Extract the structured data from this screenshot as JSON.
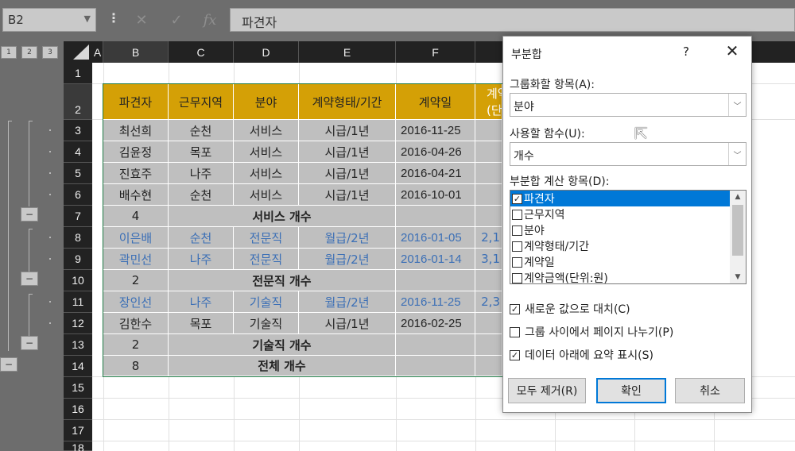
{
  "formula_bar": {
    "name_box": "B2",
    "formula": "파견자",
    "cancel_glyph": "✕",
    "enter_glyph": "✓",
    "fx_glyph": "fx"
  },
  "outline": {
    "levels": [
      "1",
      "2",
      "3"
    ],
    "collapse_glyph": "−"
  },
  "columns": [
    "A",
    "B",
    "C",
    "D",
    "E",
    "F"
  ],
  "rows": [
    "1",
    "2",
    "3",
    "4",
    "5",
    "6",
    "7",
    "8",
    "9",
    "10",
    "11",
    "12",
    "13",
    "14",
    "15",
    "16",
    "17",
    "18"
  ],
  "table": {
    "headers": [
      "파견자",
      "근무지역",
      "분야",
      "계약형태/기간",
      "계약일",
      "계약",
      "(단"
    ],
    "data_rows": [
      {
        "cells": [
          "최선희",
          "순천",
          "서비스",
          "시급/1년",
          "2016-11-25",
          ""
        ],
        "blue": false
      },
      {
        "cells": [
          "김윤정",
          "목포",
          "서비스",
          "시급/1년",
          "2016-04-26",
          ""
        ],
        "blue": false
      },
      {
        "cells": [
          "진효주",
          "나주",
          "서비스",
          "시급/1년",
          "2016-04-21",
          ""
        ],
        "blue": false
      },
      {
        "cells": [
          "배수현",
          "순천",
          "서비스",
          "시급/1년",
          "2016-10-01",
          ""
        ],
        "blue": false
      },
      {
        "cells": [
          "이은배",
          "순천",
          "전문직",
          "월급/2년",
          "2016-01-05",
          "2,1"
        ],
        "blue": true
      },
      {
        "cells": [
          "곽민선",
          "나주",
          "전문직",
          "월급/2년",
          "2016-01-14",
          "3,1"
        ],
        "blue": true
      },
      {
        "cells": [
          "장인선",
          "나주",
          "기술직",
          "월급/2년",
          "2016-11-25",
          "2,3"
        ],
        "blue": true
      },
      {
        "cells": [
          "김한수",
          "목포",
          "기술직",
          "시급/1년",
          "2016-02-25",
          ""
        ],
        "blue": false
      }
    ],
    "subtotals": [
      {
        "count": "4",
        "label": "서비스 개수"
      },
      {
        "count": "2",
        "label": "전문직 개수"
      },
      {
        "count": "2",
        "label": "기술직 개수"
      },
      {
        "count": "8",
        "label": "전체 개수"
      }
    ]
  },
  "dialog": {
    "title": "부분합",
    "help": "?",
    "close": "✕",
    "group_label": "그룹화할 항목(A):",
    "group_value": "분야",
    "func_label": "사용할 함수(U):",
    "func_value": "개수",
    "calc_label": "부분합 계산 항목(D):",
    "calc_items": [
      {
        "label": "파견자",
        "checked": true
      },
      {
        "label": "근무지역",
        "checked": false
      },
      {
        "label": "분야",
        "checked": false
      },
      {
        "label": "계약형태/기간",
        "checked": false
      },
      {
        "label": "계약일",
        "checked": false
      },
      {
        "label": "계약금액(단위:원)",
        "checked": false
      }
    ],
    "options": [
      {
        "label": "새로운 값으로 대치(C)",
        "checked": true
      },
      {
        "label": "그룹 사이에서 페이지 나누기(P)",
        "checked": false
      },
      {
        "label": "데이터 아래에 요약 표시(S)",
        "checked": true
      }
    ],
    "buttons": {
      "remove_all": "모두 제거(R)",
      "ok": "확인",
      "cancel": "취소"
    },
    "dropdown_glyph": "﹀",
    "check_glyph": "✓",
    "scroll_up": "▲",
    "scroll_down": "▼"
  },
  "cursor_glyph": "⇱"
}
